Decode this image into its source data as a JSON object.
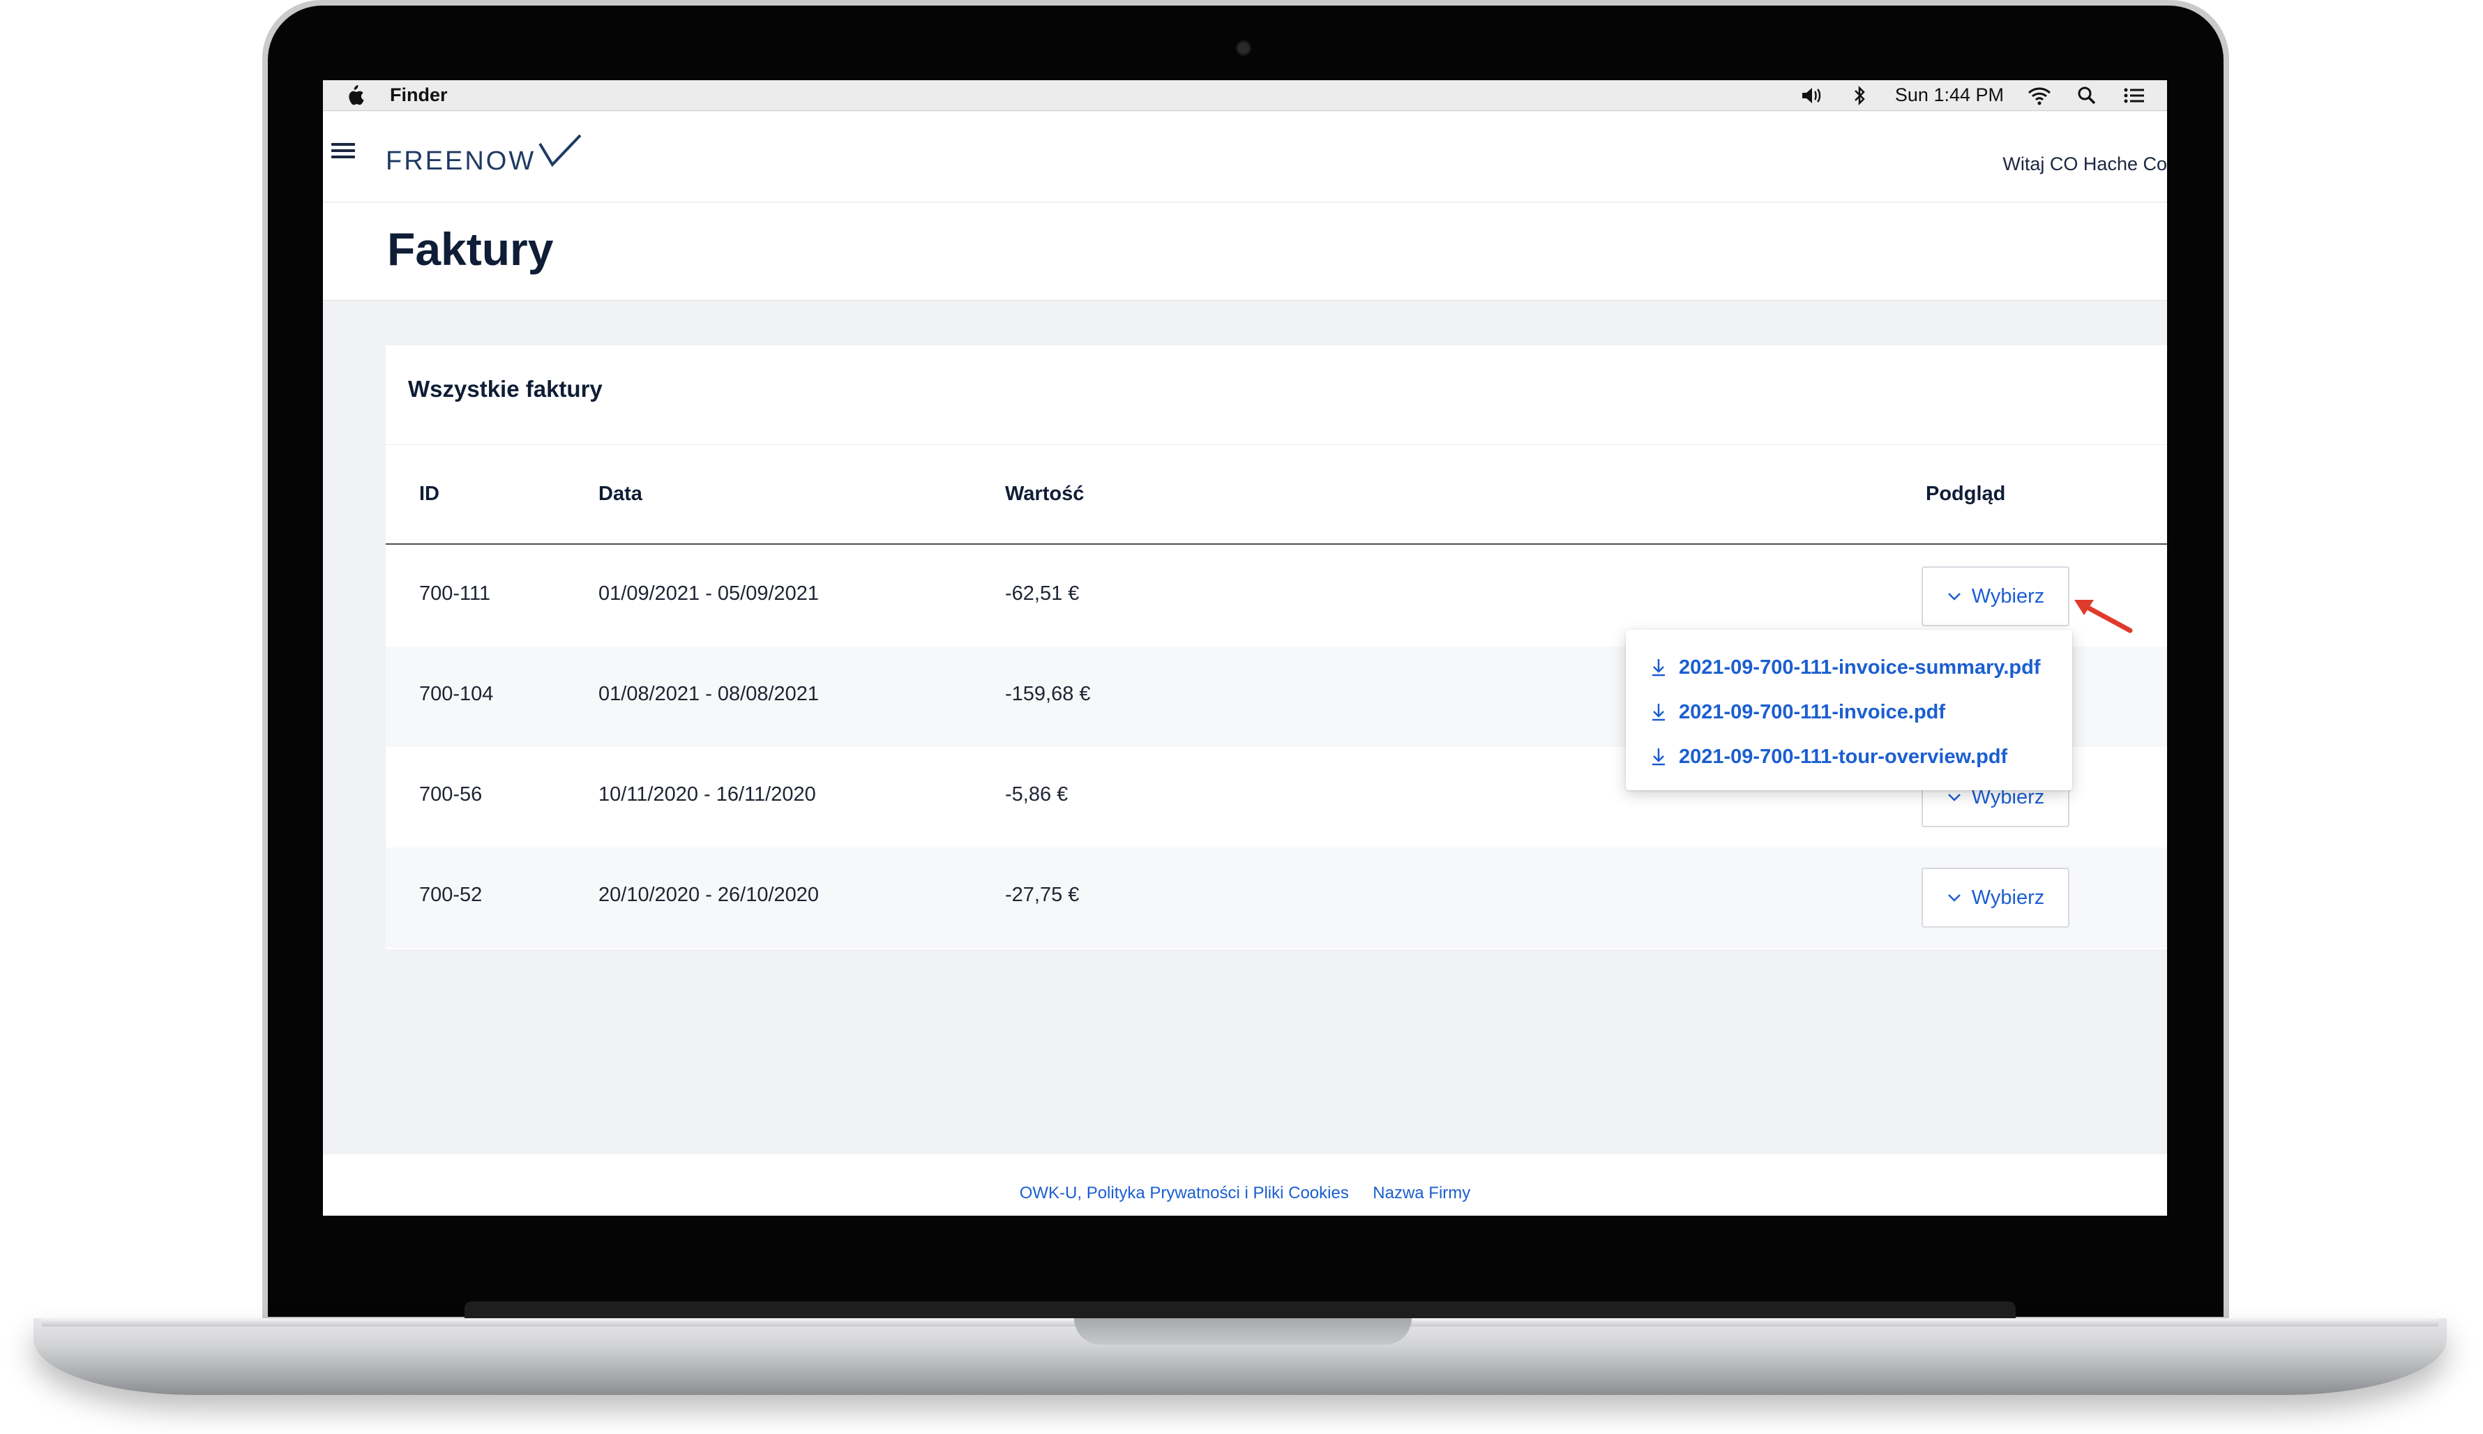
{
  "menubar": {
    "app_name": "Finder",
    "clock": "Sun 1:44 PM",
    "icons": [
      "apple-icon",
      "volume-icon",
      "bluetooth-icon",
      "wifi-icon",
      "search-icon",
      "list-icon"
    ]
  },
  "header": {
    "logo": "FREENOW",
    "greeting": "Witaj CO Hache Co"
  },
  "page": {
    "title": "Faktury"
  },
  "invoices": {
    "title": "Wszystkie faktury",
    "columns": {
      "id": "ID",
      "date": "Data",
      "value": "Wartość",
      "preview": "Podgląd"
    },
    "select_label": "Wybierz",
    "rows": [
      {
        "id": "700-111",
        "date": "01/09/2021 - 05/09/2021",
        "value": "-62,51 €"
      },
      {
        "id": "700-104",
        "date": "01/08/2021 - 08/08/2021",
        "value": "-159,68 €"
      },
      {
        "id": "700-56",
        "date": "10/11/2020 - 16/11/2020",
        "value": "-5,86 €"
      },
      {
        "id": "700-52",
        "date": "20/10/2020 - 26/10/2020",
        "value": "-27,75 €"
      }
    ]
  },
  "dropdown": {
    "items": [
      "2021-09-700-111-invoice-summary.pdf",
      "2021-09-700-111-invoice.pdf",
      "2021-09-700-111-tour-overview.pdf"
    ]
  },
  "footer": {
    "links": [
      "OWK-U, Polityka Prywatności i Pliki Cookies",
      "Nazwa Firmy"
    ]
  },
  "colors": {
    "brand": "#1f3a63",
    "link": "#1b5ed1",
    "annotation": "#e03a2c"
  }
}
